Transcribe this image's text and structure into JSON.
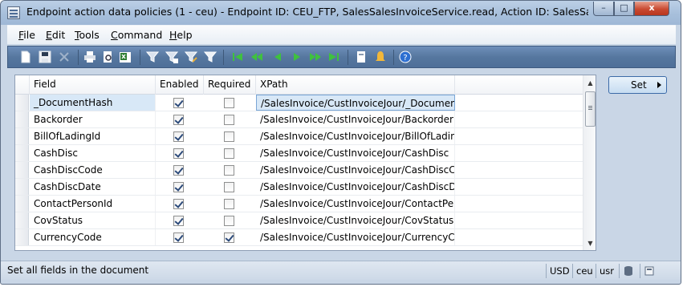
{
  "window": {
    "title": "Endpoint action data policies (1 - ceu) - Endpoint ID: CEU_FTP, SalesSalesInvoiceService.read, Action ID: SalesSalesInvoiceService.re...",
    "minimize_label": "–",
    "maximize_label": "□",
    "close_label": "x"
  },
  "menu": {
    "file": "File",
    "edit": "Edit",
    "tools": "Tools",
    "command": "Command",
    "help": "Help"
  },
  "toolbar": {
    "icons": [
      "new-icon",
      "save-icon",
      "delete-icon",
      "print-icon",
      "print-preview-icon",
      "excel-export-icon",
      "filter-by-selection-icon",
      "filter-by-grid-icon",
      "advanced-filter-icon",
      "remove-filter-icon",
      "first-record-icon",
      "previous-page-icon",
      "previous-record-icon",
      "next-record-icon",
      "next-page-icon",
      "last-record-icon",
      "attachments-icon",
      "alerts-icon",
      "help-icon"
    ]
  },
  "grid": {
    "columns": {
      "field": "Field",
      "enabled": "Enabled",
      "required": "Required",
      "xpath": "XPath"
    },
    "rows": [
      {
        "field": "_DocumentHash",
        "enabled": true,
        "required": false,
        "xpath": "/SalesInvoice/CustInvoiceJour/_Document..."
      },
      {
        "field": "Backorder",
        "enabled": true,
        "required": false,
        "xpath": "/SalesInvoice/CustInvoiceJour/Backorder"
      },
      {
        "field": "BillOfLadingId",
        "enabled": true,
        "required": false,
        "xpath": "/SalesInvoice/CustInvoiceJour/BillOfLadingId"
      },
      {
        "field": "CashDisc",
        "enabled": true,
        "required": false,
        "xpath": "/SalesInvoice/CustInvoiceJour/CashDisc"
      },
      {
        "field": "CashDiscCode",
        "enabled": true,
        "required": false,
        "xpath": "/SalesInvoice/CustInvoiceJour/CashDiscCo..."
      },
      {
        "field": "CashDiscDate",
        "enabled": true,
        "required": false,
        "xpath": "/SalesInvoice/CustInvoiceJour/CashDiscDate"
      },
      {
        "field": "ContactPersonId",
        "enabled": true,
        "required": false,
        "xpath": "/SalesInvoice/CustInvoiceJour/ContactPers..."
      },
      {
        "field": "CovStatus",
        "enabled": true,
        "required": false,
        "xpath": "/SalesInvoice/CustInvoiceJour/CovStatus"
      },
      {
        "field": "CurrencyCode",
        "enabled": true,
        "required": true,
        "xpath": "/SalesInvoice/CustInvoiceJour/CurrencyCo..."
      }
    ],
    "selected_row": 0
  },
  "actions": {
    "set_label": "Set"
  },
  "statusbar": {
    "message": "Set all fields in the document",
    "currency": "USD",
    "company": "ceu",
    "layer": "usr"
  }
}
